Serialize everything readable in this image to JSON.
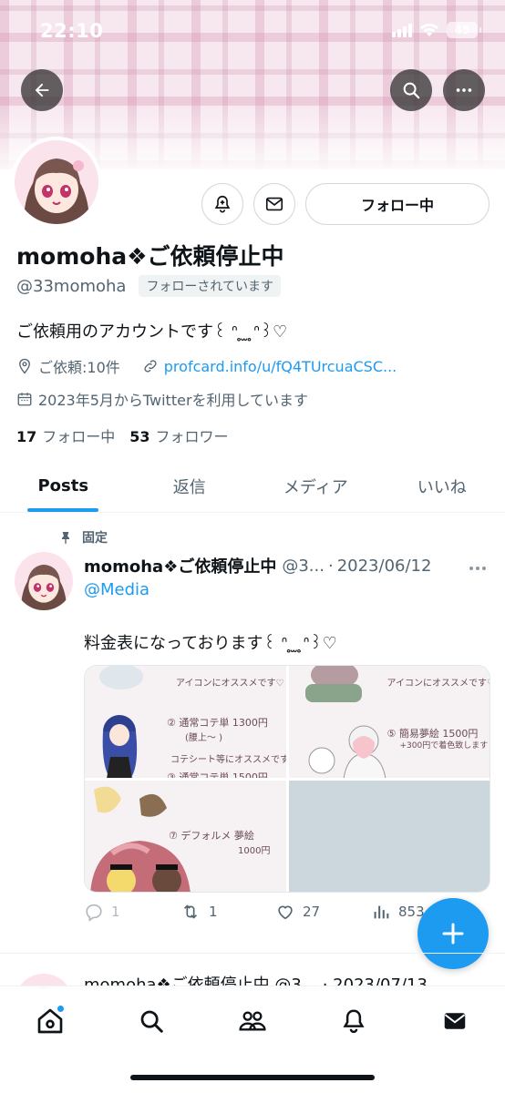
{
  "status_bar": {
    "time": "22:10",
    "battery": "45"
  },
  "profile": {
    "display_name": "momoha❖ご依頼停止中",
    "handle": "@33momoha",
    "follows_you": "フォローされています",
    "follow_button": "フォロー中",
    "bio": "ご依頼用のアカウントです꒰ ᐢ ̥ ̫ ̥ᐢ꒱♡",
    "location": "ご依頼:10件",
    "link": "profcard.info/u/fQ4TUrcuaCSC...",
    "joined": "2023年5月からTwitterを利用しています",
    "following_count": "17",
    "following_label": "フォロー中",
    "followers_count": "53",
    "followers_label": "フォロワー"
  },
  "tabs": [
    {
      "label": "Posts",
      "active": true
    },
    {
      "label": "返信"
    },
    {
      "label": "メディア"
    },
    {
      "label": "いいね"
    }
  ],
  "tweet": {
    "pinned_label": "固定",
    "name": "momoha❖ご依頼停止中",
    "handle": "@3...",
    "separator": "·",
    "date": "2023/06/12",
    "mention": "@Media",
    "text": "料金表になっております꒰ ᐢ ̥ ̫ ̥ᐢ꒱♡",
    "media_text": {
      "tl_top": "アイコンにオススメです♡",
      "tl_item": "② 通常コテ単 1300円",
      "tl_sub": "(腰上〜 )",
      "tl_note": "コテシート等にオススメです♡",
      "tl_bottom": "③ 通常コテ単 1500円",
      "tr_top": "アイコンにオススメです♡",
      "tr_item": "⑤ 簡易夢絵 1500円",
      "tr_sub": "+300円で着色致します",
      "bl_item": "⑦ デフォルメ 夢絵",
      "bl_price": "1000円"
    },
    "replies": "1",
    "retweets": "1",
    "likes": "27",
    "views": "853"
  },
  "next_tweet": {
    "head": "momoha❖ご依頼停止中 @3... · 2023/07/13"
  },
  "colors": {
    "accent": "#1d9bf0",
    "text": "#0f1419",
    "muted": "#536471"
  }
}
